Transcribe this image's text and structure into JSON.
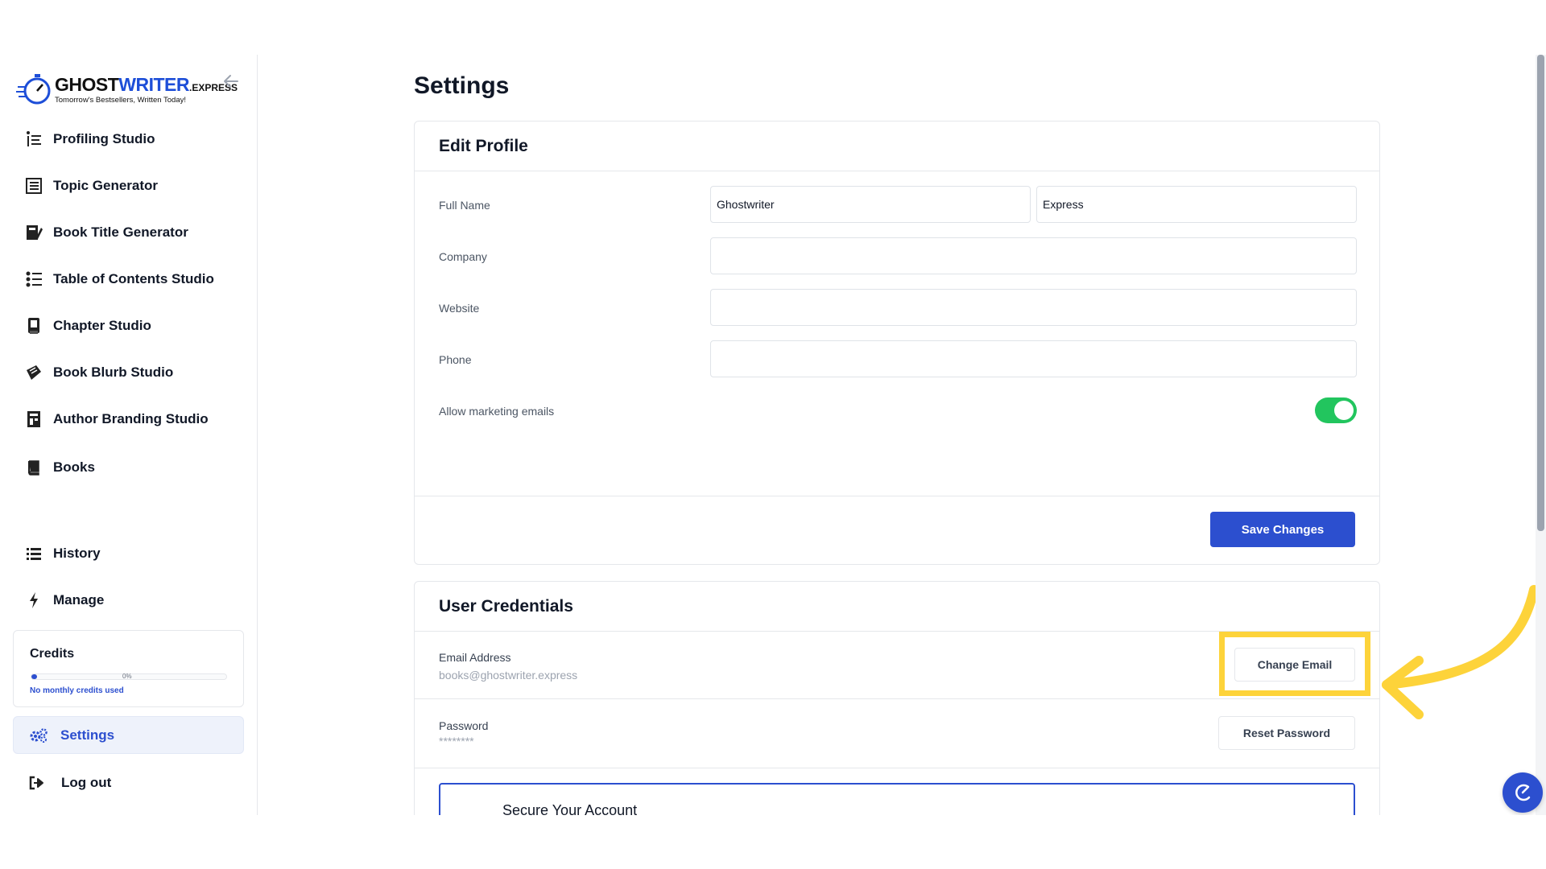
{
  "brand": {
    "name_part1": "GHOST",
    "name_part2": "WRITER",
    "name_suffix": ".EXPRESS",
    "tagline": "Tomorrow's Bestsellers, Written Today!"
  },
  "sidebar": {
    "items": [
      {
        "label": "Profiling Studio",
        "icon": "profiling-icon"
      },
      {
        "label": "Topic Generator",
        "icon": "topic-icon"
      },
      {
        "label": "Book Title Generator",
        "icon": "title-icon"
      },
      {
        "label": "Table of Contents Studio",
        "icon": "toc-icon"
      },
      {
        "label": "Chapter Studio",
        "icon": "chapter-icon"
      },
      {
        "label": "Book Blurb Studio",
        "icon": "blurb-icon"
      },
      {
        "label": "Author Branding Studio",
        "icon": "branding-icon"
      },
      {
        "label": "Books",
        "icon": "book-icon"
      },
      {
        "label": "History",
        "icon": "list-icon"
      },
      {
        "label": "Manage",
        "icon": "lightning-icon"
      }
    ],
    "credits": {
      "title": "Credits",
      "percent_label": "0%",
      "progress": 0.03,
      "note": "No monthly credits used"
    },
    "settings_label": "Settings",
    "logout_label": "Log out"
  },
  "page": {
    "title": "Settings"
  },
  "edit_profile": {
    "heading": "Edit Profile",
    "full_name_label": "Full Name",
    "first_name": "Ghostwriter",
    "last_name": "Express",
    "company_label": "Company",
    "company_value": "",
    "website_label": "Website",
    "website_value": "",
    "phone_label": "Phone",
    "phone_value": "",
    "marketing_label": "Allow marketing emails",
    "marketing_enabled": true,
    "save_label": "Save Changes"
  },
  "credentials": {
    "heading": "User Credentials",
    "email_label": "Email Address",
    "email_value": "books@ghostwriter.express",
    "change_email_label": "Change Email",
    "password_label": "Password",
    "password_value": "********",
    "reset_password_label": "Reset Password"
  },
  "secure": {
    "title": "Secure Your Account"
  },
  "colors": {
    "accent": "#2c4fcf",
    "toggle_on": "#22c55e",
    "highlight": "#fdd33a"
  }
}
